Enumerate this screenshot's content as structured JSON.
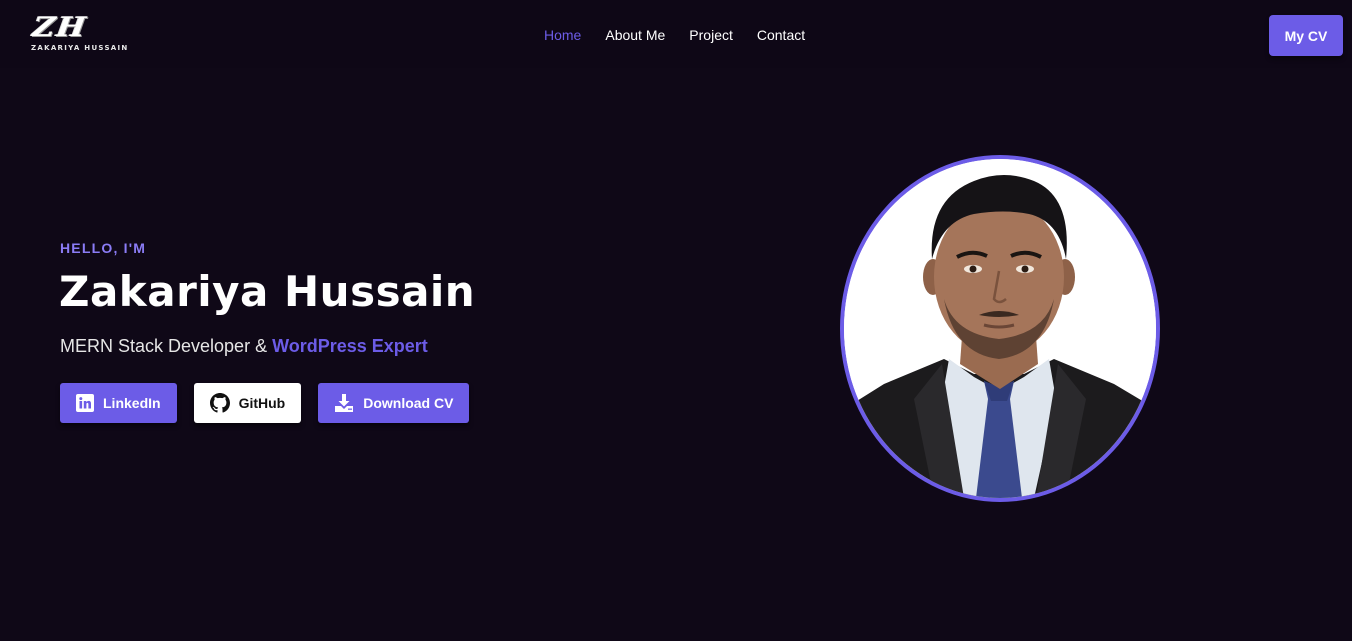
{
  "brand": {
    "logo_mark": "ZH",
    "logo_text": "ZAKARIYA HUSSAIN"
  },
  "nav": {
    "items": [
      {
        "label": "Home",
        "active": true
      },
      {
        "label": "About Me",
        "active": false
      },
      {
        "label": "Project",
        "active": false
      },
      {
        "label": "Contact",
        "active": false
      }
    ],
    "cta_label": "My CV"
  },
  "hero": {
    "greeting": "HELLO, I'M",
    "name": "Zakariya Hussain",
    "subtitle_plain": "MERN Stack Developer & ",
    "subtitle_highlight": "WordPress Expert",
    "buttons": [
      {
        "label": "LinkedIn",
        "icon": "linkedin-icon"
      },
      {
        "label": "GitHub",
        "icon": "github-icon"
      },
      {
        "label": "Download CV",
        "icon": "download-icon"
      }
    ],
    "photo_icon": "profile-photo"
  },
  "colors": {
    "background": "#0f0817",
    "accent": "#6c5ce7",
    "accent_light": "#8b7cf6",
    "text": "#ffffff"
  }
}
